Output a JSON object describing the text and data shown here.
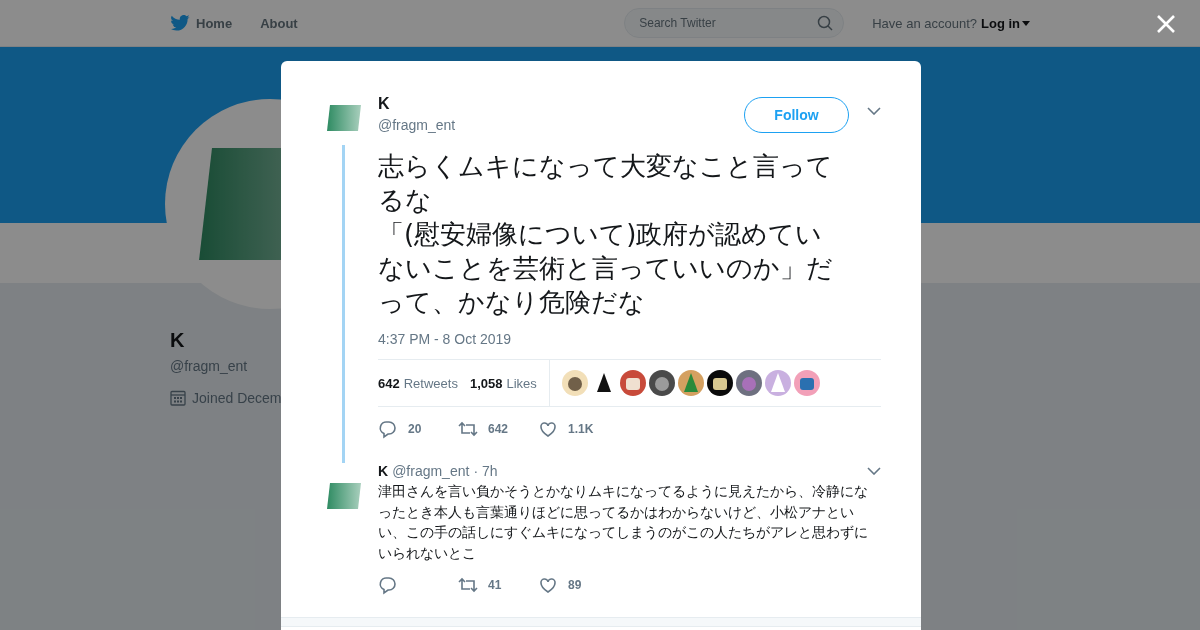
{
  "nav": {
    "items": [
      {
        "label": "Home"
      },
      {
        "label": "About"
      }
    ],
    "search": {
      "placeholder": "Search Twitter"
    },
    "account_prompt": "Have an account?",
    "login": "Log in"
  },
  "profile": {
    "name": "K",
    "handle": "@fragm_ent",
    "joined": "Joined Decem"
  },
  "tweet": {
    "name": "K",
    "handle": "@fragm_ent",
    "follow": "Follow",
    "text": [
      "志らくムキになって大変なこと言ってるな",
      "「(慰安婦像について)政府が認めていないことを芸術と言っていいのか」だって、かなり危険だな"
    ],
    "time": "4:37 PM - 8 Oct 2019",
    "retweets": {
      "count": "642",
      "label": "Retweets"
    },
    "likes": {
      "count": "1,058",
      "label": "Likes"
    },
    "actions": {
      "replies": "20",
      "retweets": "642",
      "likes": "1.1K"
    }
  },
  "replies": [
    {
      "name": "K",
      "handle": "@fragm_ent",
      "time": "· 7h",
      "text": "津田さんを言い負かそうとかなりムキになってるように見えたから、冷静になったとき本人も言葉通りほどに思ってるかはわからないけど、小松アナといい、この手の話しにすぐムキになってしまうのがこの人たちがアレと思わずにいられないとこ",
      "actions": {
        "retweets": "41",
        "likes": "89"
      }
    }
  ]
}
